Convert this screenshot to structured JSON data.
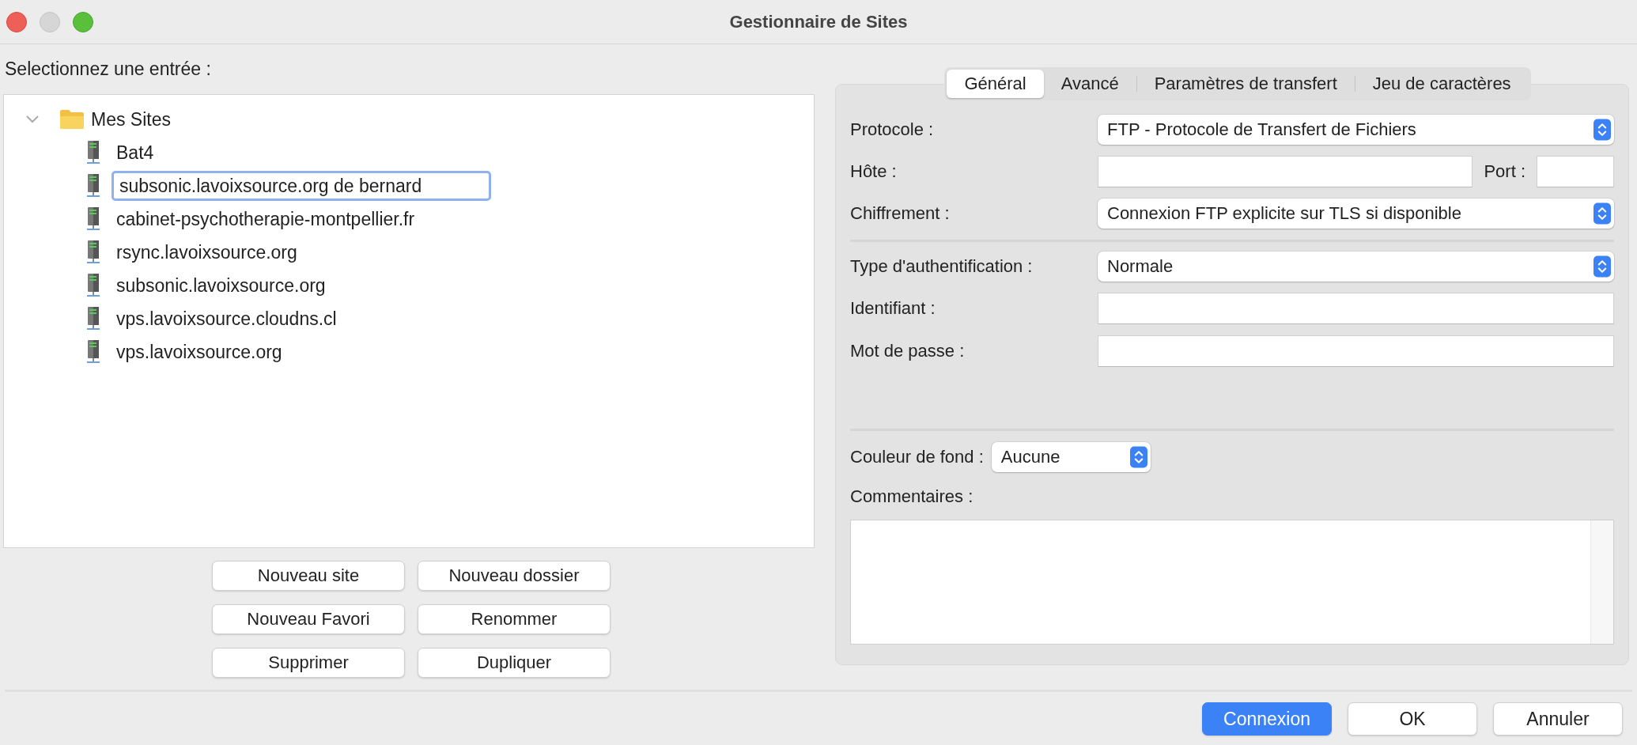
{
  "window": {
    "title": "Gestionnaire de Sites"
  },
  "site_list": {
    "label": "Selectionnez une entrée :",
    "tree": [
      {
        "label": "Mes Sites",
        "expanded": true,
        "children": [
          {
            "label": "Bat4",
            "editing": false
          },
          {
            "label": "subsonic.lavoixsource.org de bernard",
            "editing": true
          },
          {
            "label": "cabinet-psychotherapie-montpellier.fr",
            "editing": false
          },
          {
            "label": "rsync.lavoixsource.org",
            "editing": false
          },
          {
            "label": "subsonic.lavoixsource.org",
            "editing": false
          },
          {
            "label": "vps.lavoixsource.cloudns.cl",
            "editing": false
          },
          {
            "label": "vps.lavoixsource.org",
            "editing": false
          }
        ]
      }
    ]
  },
  "site_buttons": [
    "Nouveau site",
    "Nouveau dossier",
    "Nouveau Favori",
    "Renommer",
    "Supprimer",
    "Dupliquer"
  ],
  "tabs": [
    {
      "label": "Général",
      "selected": true
    },
    {
      "label": "Avancé",
      "selected": false
    },
    {
      "label": "Paramètres de transfert",
      "selected": false
    },
    {
      "label": "Jeu de caractères",
      "selected": false
    }
  ],
  "connection_fields": [
    {
      "kind": "select",
      "label": "Protocole :",
      "value": "FTP - Protocole de Transfert de Fichiers"
    },
    {
      "kind": "host",
      "label": "Hôte :",
      "port_label": "Port :"
    },
    {
      "kind": "select",
      "label": "Chiffrement :",
      "value": "Connexion FTP explicite sur TLS si disponible"
    }
  ],
  "login_fields": [
    {
      "kind": "select",
      "label": "Type d'authentification :",
      "value": "Normale"
    },
    {
      "kind": "text",
      "label": "Identifiant :"
    },
    {
      "kind": "password",
      "label": "Mot de passe :"
    }
  ],
  "background_color": {
    "label": "Couleur de fond :",
    "value": "Aucune"
  },
  "comments": {
    "label": "Commentaires :"
  },
  "footer_buttons": [
    {
      "label": "Connexion",
      "default": true
    },
    {
      "label": "OK",
      "default": false
    },
    {
      "label": "Annuler",
      "default": false
    }
  ]
}
